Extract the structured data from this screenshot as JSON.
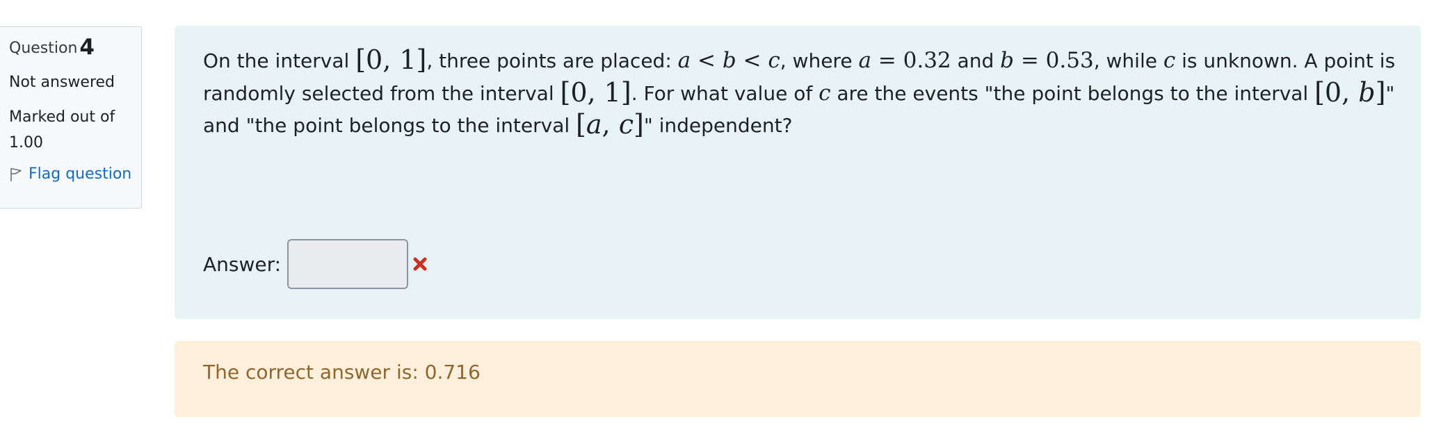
{
  "info": {
    "question_label": "Question",
    "question_number": "4",
    "state": "Not answered",
    "grade": "Marked out of 1.00",
    "flag_label": "Flag question"
  },
  "question": {
    "t1": "On the interval ",
    "m1": "[0, 1]",
    "t2": ", three points are placed: ",
    "m2a": "a",
    "m2b": " < ",
    "m2c": "b",
    "m2d": " < ",
    "m2e": "c",
    "t3": ", where ",
    "m3a": "a",
    "m3b": " = 0.32",
    "t4": " and ",
    "m4a": "b",
    "m4b": " = 0.53",
    "t5": ", while ",
    "m5": "c",
    "t6": " is unknown. A point is randomly selected from the interval ",
    "m6": "[0, 1]",
    "t7": ". For what value of ",
    "m7": "c",
    "t8": " are the events \"the point belongs to the interval ",
    "m8a": "[0, ",
    "m8b": "b",
    "m8c": "]",
    "t9": "\" and \"the point belongs to the interval ",
    "m9a": "[",
    "m9b": "a",
    "m9c": ", ",
    "m9d": "c",
    "m9e": "]",
    "t10": "\" independent?"
  },
  "answer": {
    "label": "Answer:",
    "value": ""
  },
  "feedback": {
    "right_answer": "The correct answer is: 0.716"
  },
  "colors": {
    "content_bg": "#e7f3f5",
    "feedback_bg": "#fcefdc",
    "feedback_text": "#8e662e",
    "link": "#0f6cbf",
    "incorrect": "#ca3120"
  }
}
